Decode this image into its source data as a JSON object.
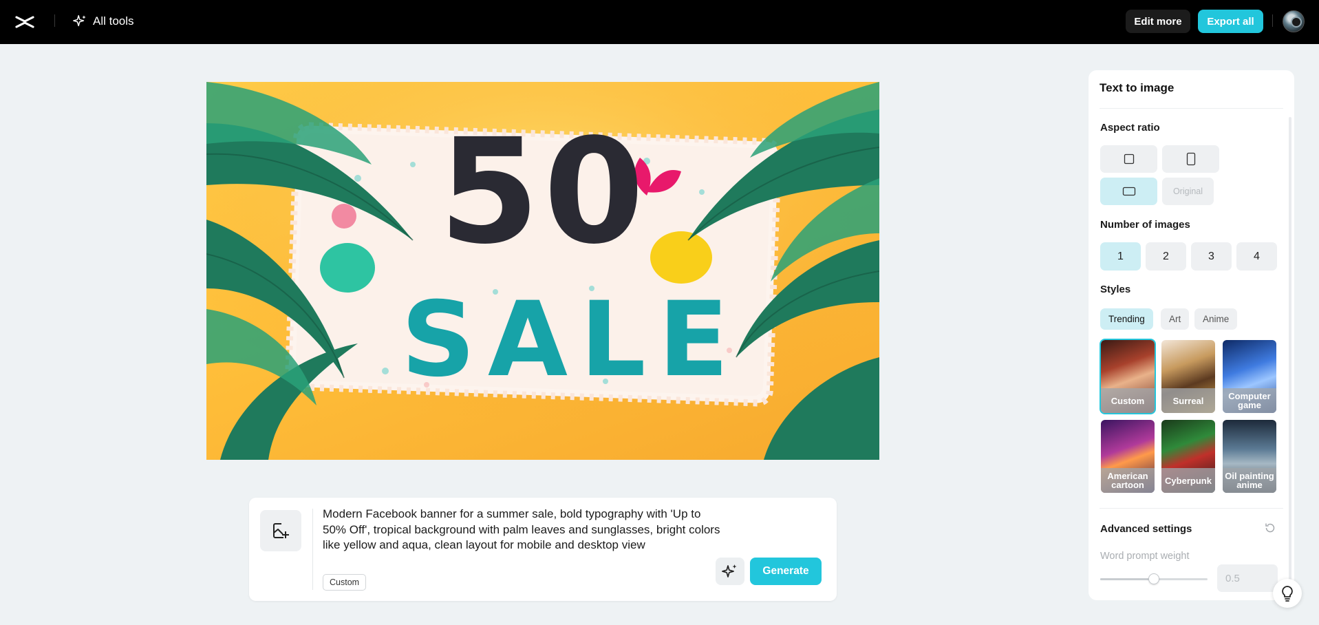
{
  "topbar": {
    "logo": "capcut-logo",
    "all_tools_label": "All tools",
    "edit_more_label": "Edit more",
    "export_all_label": "Export all",
    "avatar": "user-avatar"
  },
  "canvas": {
    "image_headline": "50",
    "image_subline": "SALE",
    "image_description": "summer sale banner with palm leaves"
  },
  "prompt": {
    "text": "Modern Facebook banner for a summer sale, bold typography with 'Up to 50% Off', tropical background with palm leaves and sunglasses, bright colors like yellow and aqua, clean layout for mobile and desktop view",
    "style_chip": "Custom",
    "generate_label": "Generate"
  },
  "panel": {
    "title": "Text to image",
    "aspect_ratio": {
      "label": "Aspect ratio",
      "options": [
        {
          "name": "square",
          "icon": "square-ratio-icon"
        },
        {
          "name": "portrait",
          "icon": "portrait-ratio-icon"
        },
        {
          "name": "landscape",
          "icon": "landscape-ratio-icon",
          "active": true
        },
        {
          "name": "original",
          "label": "Original",
          "disabled": true
        }
      ]
    },
    "number_of_images": {
      "label": "Number of images",
      "options": [
        "1",
        "2",
        "3",
        "4"
      ],
      "selected": "1"
    },
    "styles": {
      "label": "Styles",
      "tabs": [
        "Trending",
        "Art",
        "Anime"
      ],
      "active_tab": "Trending",
      "cards": [
        "Custom",
        "Surreal",
        "Computer game",
        "American cartoon",
        "Cyberpunk",
        "Oil painting anime"
      ],
      "selected": "Custom"
    },
    "advanced": {
      "label": "Advanced settings",
      "word_prompt_weight_label": "Word prompt weight",
      "word_prompt_weight_value": "0.5",
      "slider_fraction": 0.5
    }
  },
  "colors": {
    "accent": "#22c6dc",
    "accent_light": "#cdeef4",
    "topbar": "#000000",
    "background": "#eef2f4"
  }
}
